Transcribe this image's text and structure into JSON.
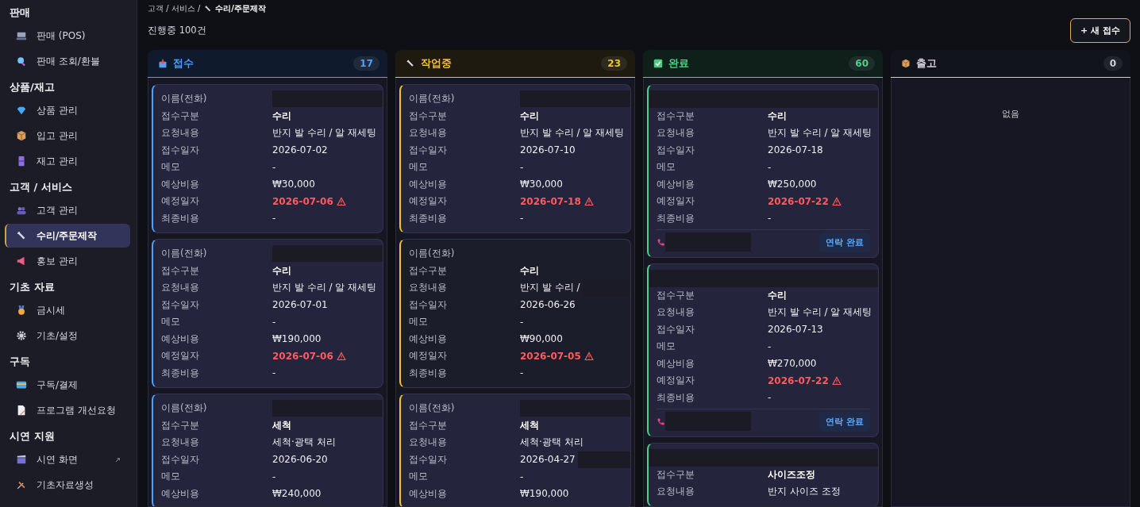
{
  "sidebar": {
    "sections": [
      {
        "title": "판매",
        "items": [
          {
            "label": "판매 (POS)",
            "selected": false
          },
          {
            "label": "판매 조회/환불",
            "selected": false
          }
        ]
      },
      {
        "title": "상품/재고",
        "items": [
          {
            "label": "상품 관리",
            "selected": false
          },
          {
            "label": "입고 관리",
            "selected": false
          },
          {
            "label": "재고 관리",
            "selected": false
          }
        ]
      },
      {
        "title": "고객 / 서비스",
        "items": [
          {
            "label": "고객 관리",
            "selected": false
          },
          {
            "label": "수리/주문제작",
            "selected": true
          },
          {
            "label": "홍보 관리",
            "selected": false
          }
        ]
      },
      {
        "title": "기초 자료",
        "items": [
          {
            "label": "금시세",
            "selected": false
          },
          {
            "label": "기초/설정",
            "selected": false
          }
        ]
      },
      {
        "title": "구독",
        "items": [
          {
            "label": "구독/결제",
            "selected": false
          },
          {
            "label": "프로그램 개선요청",
            "selected": false
          }
        ]
      },
      {
        "title": "시연 지원",
        "items": [
          {
            "label": "시연 화면",
            "selected": false,
            "external": true
          },
          {
            "label": "기초자료생성",
            "selected": false
          }
        ]
      }
    ]
  },
  "breadcrumb": {
    "parents": "고객 / 서비스 /",
    "current": "수리/주문제작"
  },
  "summary": "진행중 100건",
  "new_button": "+ 새 접수",
  "columns": [
    {
      "title": "접수",
      "count": "17",
      "color": "#4ea1ff",
      "cards": [
        {
          "fields": [
            {
              "label": "이름(전화)",
              "kind": "masked"
            },
            {
              "label": "접수구분",
              "value": "수리",
              "kind": "bold"
            },
            {
              "label": "요청내용",
              "value": "반지 발 수리 / 알 재세팅",
              "kind": "plain"
            },
            {
              "label": "접수일자",
              "value": "2026-07-02",
              "kind": "plain"
            },
            {
              "label": "메모",
              "value": "-",
              "kind": "plain"
            },
            {
              "label": "예상비용",
              "value": "₩30,000",
              "kind": "plain"
            },
            {
              "label": "예정일자",
              "value": "2026-07-06",
              "kind": "overdue"
            },
            {
              "label": "최종비용",
              "value": "-",
              "kind": "plain"
            }
          ]
        },
        {
          "fields": [
            {
              "label": "이름(전화)",
              "kind": "masked"
            },
            {
              "label": "접수구분",
              "value": "수리",
              "kind": "bold"
            },
            {
              "label": "요청내용",
              "value": "반지 발 수리 / 알 재세팅",
              "kind": "plain"
            },
            {
              "label": "접수일자",
              "value": "2026-07-01",
              "kind": "plain"
            },
            {
              "label": "메모",
              "value": "-",
              "kind": "plain"
            },
            {
              "label": "예상비용",
              "value": "₩190,000",
              "kind": "plain"
            },
            {
              "label": "예정일자",
              "value": "2026-07-06",
              "kind": "overdue"
            },
            {
              "label": "최종비용",
              "value": "-",
              "kind": "plain"
            }
          ]
        },
        {
          "fields": [
            {
              "label": "이름(전화)",
              "kind": "masked"
            },
            {
              "label": "접수구분",
              "value": "세척",
              "kind": "bold"
            },
            {
              "label": "요청내용",
              "value": "세척·광택 처리",
              "kind": "plain"
            },
            {
              "label": "접수일자",
              "value": "2026-06-20",
              "kind": "plain"
            },
            {
              "label": "메모",
              "value": "-",
              "kind": "plain"
            },
            {
              "label": "예상비용",
              "value": "₩240,000",
              "kind": "plain"
            }
          ]
        }
      ]
    },
    {
      "title": "작업중",
      "count": "23",
      "color": "#f2c230",
      "cards": [
        {
          "fields": [
            {
              "label": "이름(전화)",
              "kind": "masked"
            },
            {
              "label": "접수구분",
              "value": "수리",
              "kind": "bold"
            },
            {
              "label": "요청내용",
              "value": "반지 발 수리 / 알 재세팅",
              "kind": "plain"
            },
            {
              "label": "접수일자",
              "value": "2026-07-10",
              "kind": "plain"
            },
            {
              "label": "메모",
              "value": "-",
              "kind": "plain"
            },
            {
              "label": "예상비용",
              "value": "₩30,000",
              "kind": "plain"
            },
            {
              "label": "예정일자",
              "value": "2026-07-18",
              "kind": "overdue"
            },
            {
              "label": "최종비용",
              "value": "-",
              "kind": "plain"
            }
          ]
        },
        {
          "fields": [
            {
              "label": "이름(전화)",
              "kind": "plain"
            },
            {
              "label": "접수구분",
              "value": "수리",
              "kind": "bold"
            },
            {
              "label": "요청내용",
              "value": "반지 발 수리 /",
              "kind": "covered"
            },
            {
              "label": "접수일자",
              "value": "2026-06-26",
              "kind": "plain"
            },
            {
              "label": "메모",
              "value": "-",
              "kind": "plain"
            },
            {
              "label": "예상비용",
              "value": "₩90,000",
              "kind": "plain"
            },
            {
              "label": "예정일자",
              "value": "2026-07-05",
              "kind": "overdue"
            },
            {
              "label": "최종비용",
              "value": "-",
              "kind": "plain"
            }
          ]
        },
        {
          "fields": [
            {
              "label": "이름(전화)",
              "kind": "masked"
            },
            {
              "label": "접수구분",
              "value": "세척",
              "kind": "bold"
            },
            {
              "label": "요청내용",
              "value": "세척·광택 처리",
              "kind": "plain"
            },
            {
              "label": "접수일자",
              "value": "2026-04-27",
              "kind": "covered"
            },
            {
              "label": "메모",
              "value": "-",
              "kind": "plain"
            },
            {
              "label": "예상비용",
              "value": "₩190,000",
              "kind": "plain"
            }
          ]
        }
      ]
    },
    {
      "title": "완료",
      "count": "60",
      "color": "#4fd18b",
      "cards": [
        {
          "fields": [
            {
              "kind": "masked_row"
            },
            {
              "label": "접수구분",
              "value": "수리",
              "kind": "bold"
            },
            {
              "label": "요청내용",
              "value": "반지 발 수리 / 알 재세팅",
              "kind": "plain"
            },
            {
              "label": "접수일자",
              "value": "2026-07-18",
              "kind": "plain"
            },
            {
              "label": "메모",
              "value": "-",
              "kind": "plain"
            },
            {
              "label": "예상비용",
              "value": "₩250,000",
              "kind": "plain"
            },
            {
              "label": "예정일자",
              "value": "2026-07-22",
              "kind": "overdue"
            },
            {
              "label": "최종비용",
              "value": "-",
              "kind": "plain"
            }
          ],
          "contact_button": "연락 완료"
        },
        {
          "fields": [
            {
              "kind": "masked_row"
            },
            {
              "label": "접수구분",
              "value": "수리",
              "kind": "bold"
            },
            {
              "label": "요청내용",
              "value": "반지 발 수리 / 알 재세팅",
              "kind": "plain"
            },
            {
              "label": "접수일자",
              "value": "2026-07-13",
              "kind": "plain"
            },
            {
              "label": "메모",
              "value": "-",
              "kind": "plain"
            },
            {
              "label": "예상비용",
              "value": "₩270,000",
              "kind": "plain"
            },
            {
              "label": "예정일자",
              "value": "2026-07-22",
              "kind": "overdue"
            },
            {
              "label": "최종비용",
              "value": "-",
              "kind": "plain"
            }
          ],
          "contact_button": "연락 완료"
        },
        {
          "fields": [
            {
              "kind": "masked_row"
            },
            {
              "label": "접수구분",
              "value": "사이즈조정",
              "kind": "bold"
            },
            {
              "label": "요청내용",
              "value": "반지 사이즈 조정",
              "kind": "plain"
            }
          ]
        }
      ]
    },
    {
      "title": "출고",
      "count": "0",
      "color": "#d0d0d8",
      "empty": "없음"
    }
  ]
}
